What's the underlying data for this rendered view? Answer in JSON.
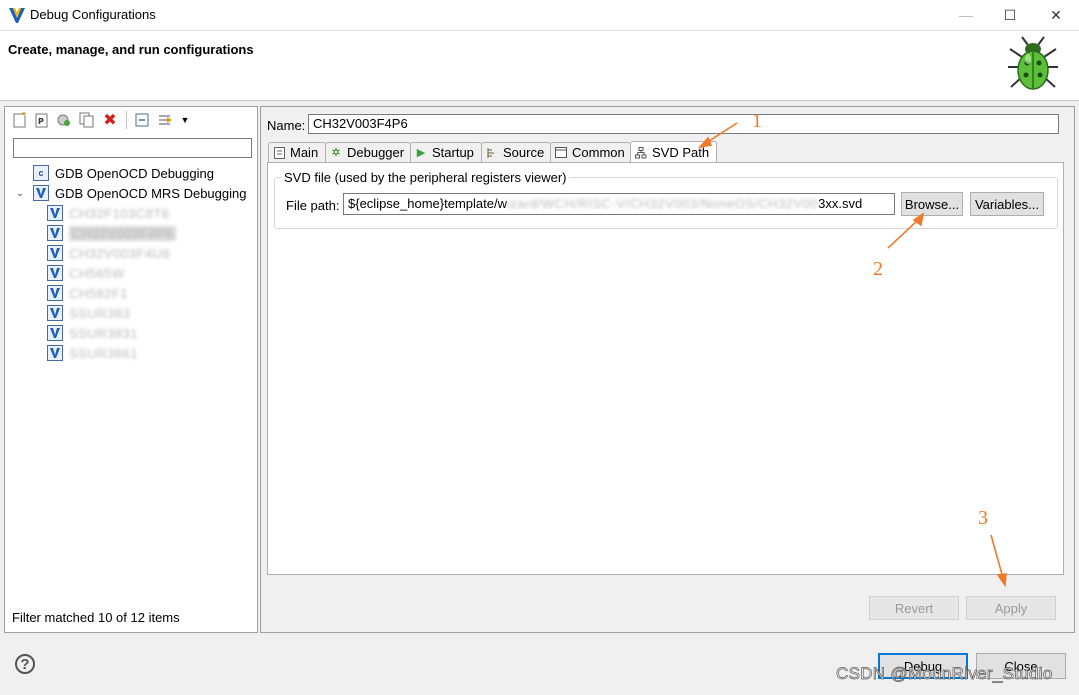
{
  "window": {
    "title": "Debug Configurations",
    "controls": {
      "minimize": "—",
      "maximize": "☐",
      "close": "✕"
    }
  },
  "header": {
    "title": "Create, manage, and run configurations"
  },
  "left_panel": {
    "filter_value": "",
    "tree": {
      "groups": [
        {
          "label": "GDB OpenOCD Debugging",
          "icon": "c-launch-icon",
          "expanded": false
        },
        {
          "label": "GDB OpenOCD MRS Debugging",
          "icon": "v-launch-icon",
          "expanded": true,
          "children": [
            "CH32F103C8T6",
            "CH32V003F4P6",
            "CH32V003F4U6",
            "CH565W",
            "CH582F1",
            "SSUR383",
            "SSUR3831",
            "SSUR3861"
          ]
        }
      ]
    },
    "filter_status": "Filter matched 10 of 12 items"
  },
  "right_panel": {
    "name_label": "Name:",
    "name_value": "CH32V003F4P6",
    "tabs": [
      "Main",
      "Debugger",
      "Startup",
      "Source",
      "Common",
      "SVD Path"
    ],
    "active_tab": "SVD Path",
    "svd_group_title": "SVD file (used by the peripheral registers viewer)",
    "file_path_label": "File path:",
    "file_path_prefix": "${eclipse_home}template/w",
    "file_path_hidden": "izard/WCH/RISC-V/CH32V003/NoneOS/CH32V00",
    "file_path_suffix": "3xx.svd",
    "browse_label": "Browse...",
    "variables_label": "Variables...",
    "revert_label": "Revert",
    "apply_label": "Apply"
  },
  "footer": {
    "help": "?",
    "debug_label": "Debug",
    "close_label": "Close"
  },
  "annotations": {
    "one": "1",
    "two": "2",
    "three": "3",
    "color": "#f07a2a"
  },
  "watermark": "CSDN @MounRiver_Studio"
}
